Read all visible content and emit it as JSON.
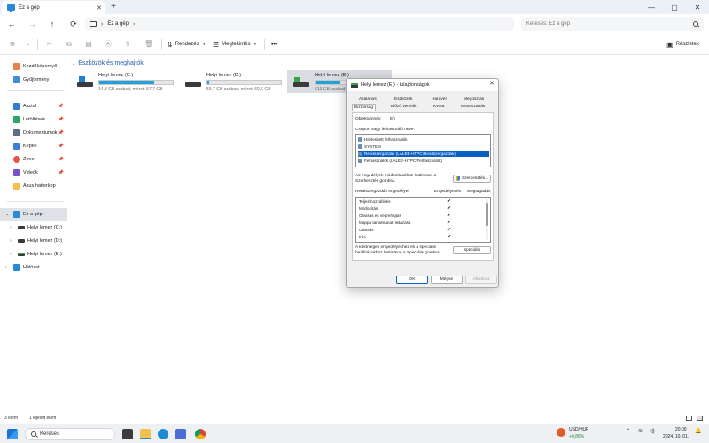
{
  "tab": {
    "label": "Ez a gép",
    "close": "✕",
    "new": "+"
  },
  "window_controls": {
    "minimize": "—",
    "maximize": "▢",
    "close": "✕"
  },
  "nav": {
    "back": "←",
    "forward": "→",
    "up": "↑",
    "refresh": "⟳"
  },
  "address": {
    "crumb": "Ez a gép",
    "sep": "›"
  },
  "search": {
    "placeholder": "Keresés: Ez a gép"
  },
  "toolbar": {
    "sort_label": "Rendezés",
    "view_label": "Megtekintés",
    "more_label": "•••",
    "details_label": "Részletek"
  },
  "sidebar": {
    "quick": [
      {
        "label": "Kezdőképernyő",
        "pinned": false
      },
      {
        "label": "Gyűjtemény",
        "pinned": false
      }
    ],
    "pinned": [
      {
        "label": "Asztal"
      },
      {
        "label": "Letöltések"
      },
      {
        "label": "Dokumentumok"
      },
      {
        "label": "Képek"
      },
      {
        "label": "Zene"
      },
      {
        "label": "Videók"
      },
      {
        "label": "Asus hatterkep"
      }
    ],
    "tree": [
      {
        "label": "Ez a gép"
      },
      {
        "label": "Helyi lemez (C:)"
      },
      {
        "label": "Helyi lemez (D:)"
      },
      {
        "label": "Helyi lemez (E:)"
      },
      {
        "label": "Hálózat"
      }
    ],
    "pin_glyph": "📌"
  },
  "main": {
    "group_title": "Eszközök és meghajtók",
    "drives": [
      {
        "name": "Helyi lemez (C:)",
        "info": "14,3 GB szabad, méret: 57,7 GB",
        "used_fraction": 0.75
      },
      {
        "name": "Helyi lemez (D:)",
        "info": "59,7 GB szabad, méret: 60,6 GB",
        "used_fraction": 0.02
      },
      {
        "name": "Helyi lemez (E:)",
        "info": "613 GB szabad, méret: 931 GB",
        "used_fraction": 0.34
      }
    ]
  },
  "status": {
    "items": "3 elem",
    "selected": "1 kijelölt elem"
  },
  "dialog": {
    "title": "Helyi lemez (E:) - tulajdonságok",
    "tabs_row1": [
      "Általános",
      "Eszközök",
      "Hardver",
      "Megosztás"
    ],
    "tabs_row2": [
      "Biztonság",
      "Előző verziók",
      "Kvóta",
      "Testreszabás"
    ],
    "object_label": "Objektumnév:",
    "object_value": "E:\\",
    "group_label": "Csoport vagy felhasználó neve:",
    "users": [
      "Hitelesített felhasználók",
      "SYSTEM",
      "Rendszergazdák (LALEE-HTPC\\Rendszergazdák)",
      "Felhasználók (LALEE-HTPC\\Felhasználók)"
    ],
    "edit_hint": "Az engedélyek módosításához kattintson a Szerkesztés gombra.",
    "edit_button": "Szerkesztés...",
    "perm_header": "Rendszergazdák engedélyei",
    "allow_header": "Engedélyezés",
    "deny_header": "Megtagadás",
    "permissions": [
      {
        "name": "Teljes hozzáférés",
        "allow": "✔"
      },
      {
        "name": "Módosítás",
        "allow": "✔"
      },
      {
        "name": "Olvasás és végrehajtás",
        "allow": "✔"
      },
      {
        "name": "Mappa tartalmának listázása",
        "allow": "✔"
      },
      {
        "name": "Olvasás",
        "allow": "✔"
      },
      {
        "name": "Írás",
        "allow": "✔"
      }
    ],
    "special_hint": "A különleges engedélyekhez és a speciális beállításokhoz kattintson a Speciális gombra.",
    "special_button": "Speciális",
    "ok": "OK",
    "cancel": "Mégse",
    "apply": "Alkalmaz"
  },
  "taskbar": {
    "search_label": "Keresés",
    "ticker_name": "USD/HUF",
    "ticker_value": "+0,86%",
    "time": "20:00",
    "date": "2024. 10. 01."
  }
}
